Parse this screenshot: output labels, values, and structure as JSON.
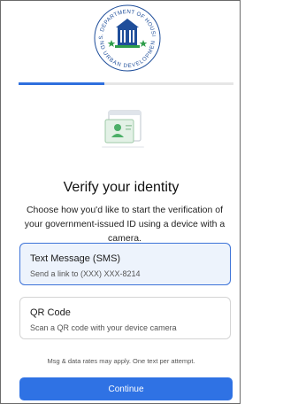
{
  "logo": {
    "seal_text_top": "U.S. DEPARTMENT OF HOUSING",
    "seal_text_bottom": "AND URBAN DEVELOPMENT",
    "icon": "hud-seal-logo"
  },
  "progress": {
    "fraction": 0.4
  },
  "illustration": {
    "icon": "id-card-verification-icon"
  },
  "page": {
    "title": "Verify your identity",
    "subtitle": "Choose how you'd like to start the verification of your government-issued ID using a device with a camera."
  },
  "options": [
    {
      "title": "Text Message (SMS)",
      "description": "Send a link to (XXX) XXX-8214",
      "selected": true
    },
    {
      "title": "QR Code",
      "description": "Scan a QR code with your device camera",
      "selected": false
    }
  ],
  "disclaimer": "Msg & data rates may apply. One text per attempt.",
  "continue_label": "Continue",
  "colors": {
    "accent": "#2f72e4",
    "selected_border": "#3d73d8",
    "selected_bg": "#edf3fc",
    "seal_blue": "#1f4e9a",
    "seal_green": "#2e9e4a"
  }
}
